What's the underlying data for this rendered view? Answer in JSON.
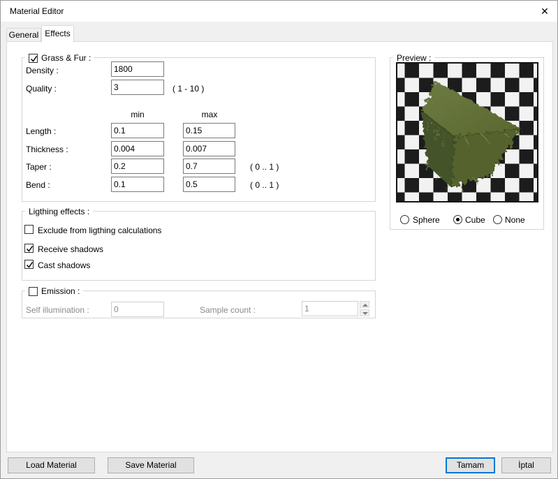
{
  "window": {
    "title": "Material Editor",
    "close_glyph": "✕"
  },
  "tabs": {
    "general": "General",
    "effects": "Effects",
    "active_tab": "Effects"
  },
  "grass": {
    "legend": "Grass & Fur :",
    "checked": true,
    "density_label": "Density :",
    "density_value": "1800",
    "quality_label": "Quality :",
    "quality_value": "3",
    "quality_hint": "( 1 - 10 )",
    "col_min": "min",
    "col_max": "max",
    "rows": [
      {
        "label": "Length :",
        "min": "0.1",
        "max": "0.15",
        "hint": ""
      },
      {
        "label": "Thickness :",
        "min": "0.004",
        "max": "0.007",
        "hint": ""
      },
      {
        "label": "Taper :",
        "min": "0.2",
        "max": "0.7",
        "hint": "( 0 .. 1 )"
      },
      {
        "label": "Bend :",
        "min": "0.1",
        "max": "0.5",
        "hint": "( 0 .. 1 )"
      }
    ]
  },
  "lighting": {
    "legend": "Ligthing effects :",
    "options": [
      {
        "label": "Exclude from ligthing calculations",
        "checked": false
      },
      {
        "label": "Receive shadows",
        "checked": true
      },
      {
        "label": "Cast shadows",
        "checked": true
      }
    ]
  },
  "emission": {
    "legend": "Emission :",
    "checked": false,
    "self_illumination_label": "Self illumination :",
    "self_illumination_value": "0",
    "sample_count_label": "Sample count :",
    "sample_count_value": "1"
  },
  "preview": {
    "legend": "Preview :",
    "shapes": [
      {
        "label": "Sphere",
        "selected": false
      },
      {
        "label": "Cube",
        "selected": true
      },
      {
        "label": "None",
        "selected": false
      }
    ]
  },
  "buttons": {
    "load": "Load Material",
    "save": "Save Material",
    "ok": "Tamam",
    "cancel": "İptal"
  },
  "colors": {
    "accent": "#0078d7",
    "grass_top": "#66743c",
    "grass_left": "#44522a",
    "grass_right": "#55622f",
    "checker_dark": "#1c1c1c",
    "checker_light": "#f2f2f2"
  }
}
